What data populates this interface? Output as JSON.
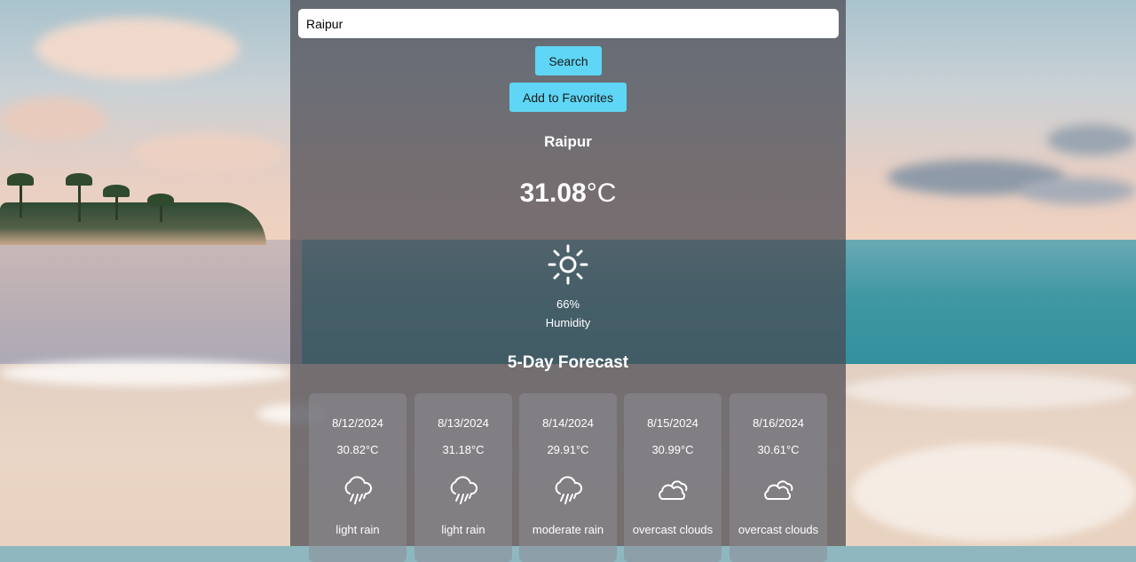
{
  "search": {
    "value": "Raipur",
    "button_label": "Search"
  },
  "favorites": {
    "button_label": "Add to Favorites"
  },
  "current": {
    "city": "Raipur",
    "temp_value": "31.08",
    "temp_unit": "°C",
    "icon": "sun-icon",
    "humidity_value": "66%",
    "humidity_label": "Humidity"
  },
  "forecast": {
    "title": "5-Day Forecast",
    "days": [
      {
        "date": "8/12/2024",
        "temp": "30.82°C",
        "icon": "rain-cloud-icon",
        "desc": "light rain"
      },
      {
        "date": "8/13/2024",
        "temp": "31.18°C",
        "icon": "rain-cloud-icon",
        "desc": "light rain"
      },
      {
        "date": "8/14/2024",
        "temp": "29.91°C",
        "icon": "rain-cloud-icon",
        "desc": "moderate rain"
      },
      {
        "date": "8/15/2024",
        "temp": "30.99°C",
        "icon": "clouds-icon",
        "desc": "overcast clouds"
      },
      {
        "date": "8/16/2024",
        "temp": "30.61°C",
        "icon": "clouds-icon",
        "desc": "overcast clouds"
      }
    ]
  },
  "colors": {
    "accent": "#5fd6f5",
    "panel": "#48484f"
  }
}
